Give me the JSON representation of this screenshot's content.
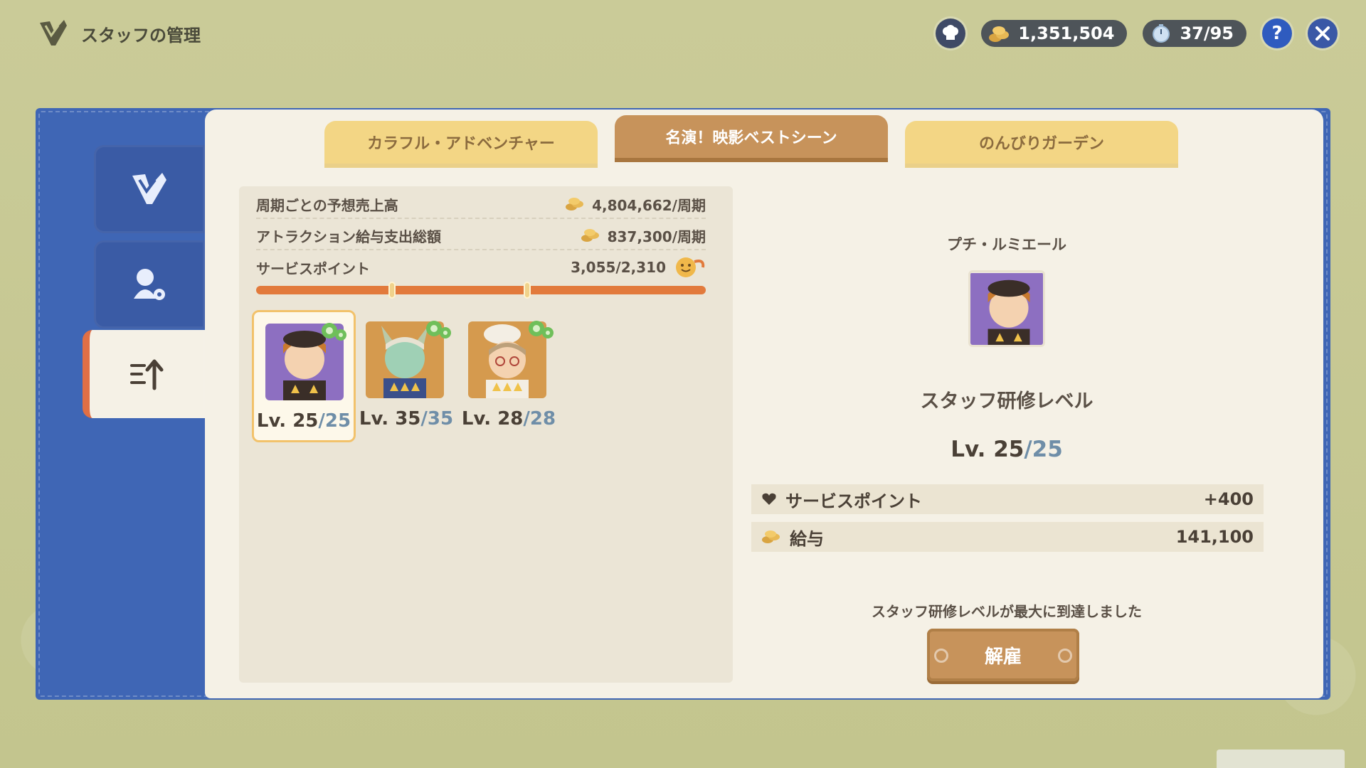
{
  "header": {
    "title": "スタッフの管理",
    "coins": "1,351,504",
    "tickets": "37/95"
  },
  "tabs": [
    {
      "label": "カラフル・アドベンチャー",
      "active": false
    },
    {
      "label": "名演！映影ベストシーン",
      "active": true
    },
    {
      "label": "のんびりガーデン",
      "active": false
    }
  ],
  "stats": {
    "sales_label": "周期ごとの予想売上高",
    "sales_value": "4,804,662/周期",
    "salary_label": "アトラクション給与支出総額",
    "salary_value": "837,300/周期",
    "service_label": "サービスポイント",
    "service_value": "3,055/2,310"
  },
  "staff": [
    {
      "lv_prefix": "Lv. 25",
      "lv_max": "/25",
      "selected": true
    },
    {
      "lv_prefix": "Lv. 35",
      "lv_max": "/35",
      "selected": false
    },
    {
      "lv_prefix": "Lv. 28",
      "lv_max": "/28",
      "selected": false
    }
  ],
  "detail": {
    "name": "プチ・ルミエール",
    "training_title": "スタッフ研修レベル",
    "lv_prefix": "Lv. 25",
    "lv_max": "/25",
    "service_label": "サービスポイント",
    "service_value": "+400",
    "salary_label": "給与",
    "salary_value": "141,100",
    "max_message": "スタッフ研修レベルが最大に到達しました",
    "fire_button": "解雇"
  },
  "colors": {
    "accent_blue": "#3f66b5",
    "tab_active": "#c7935b",
    "tab_inactive": "#f3d685",
    "progress": "#e27a3c"
  }
}
